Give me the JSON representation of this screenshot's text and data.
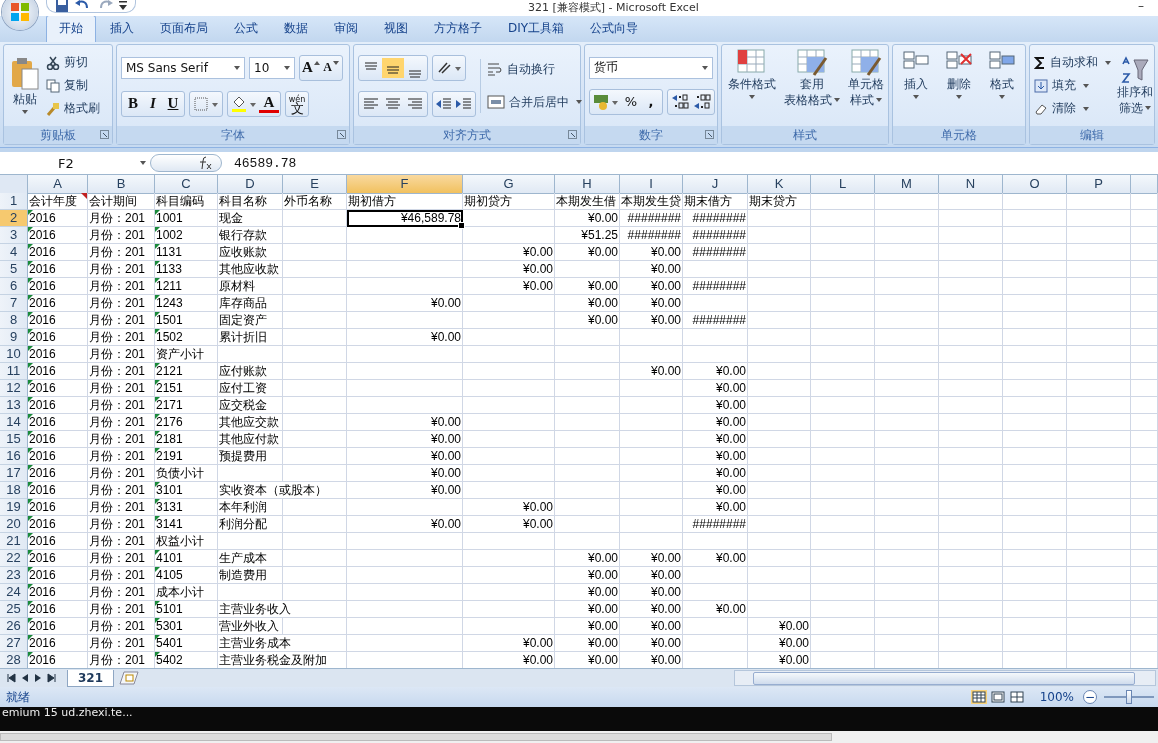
{
  "window": {
    "title": "321  [兼容模式] - Microsoft Excel",
    "minimize": "–"
  },
  "tabs": [
    {
      "label": "开始",
      "selected": true
    },
    {
      "label": "插入",
      "selected": false
    },
    {
      "label": "页面布局",
      "selected": false
    },
    {
      "label": "公式",
      "selected": false
    },
    {
      "label": "数据",
      "selected": false
    },
    {
      "label": "审阅",
      "selected": false
    },
    {
      "label": "视图",
      "selected": false
    },
    {
      "label": "方方格子",
      "selected": false
    },
    {
      "label": "DIY工具箱",
      "selected": false
    },
    {
      "label": "公式向导",
      "selected": false
    }
  ],
  "ribbon": {
    "clipboard": {
      "title": "剪贴板",
      "paste": "粘贴",
      "cut": "剪切",
      "copy": "复制",
      "painter": "格式刷"
    },
    "font": {
      "title": "字体",
      "family": "MS Sans Serif",
      "size": "10",
      "grow": "A",
      "shrink": "A",
      "bold": "B",
      "italic": "I",
      "underline": "U",
      "color_letter": "A",
      "phonetic_top": "wén",
      "phonetic": "文"
    },
    "alignment": {
      "title": "对齐方式",
      "vertical": [
        {
          "selected": false
        },
        {
          "selected": true
        },
        {
          "selected": false
        }
      ],
      "wrap": "自动换行",
      "merge": "合并后居中"
    },
    "number": {
      "title": "数字",
      "format": "货币",
      "percent": "%",
      "comma": ","
    },
    "styles": {
      "title": "样式",
      "items": [
        [
          "条件格式"
        ],
        [
          "套用",
          "表格格式"
        ],
        [
          "单元格",
          "样式"
        ]
      ]
    },
    "cells": {
      "title": "单元格",
      "items": [
        "插入",
        "删除",
        "格式"
      ]
    },
    "editing": {
      "title": "编辑",
      "autosum": "自动求和",
      "fill": "填充",
      "clear": "清除",
      "sort": [
        "排序和",
        "筛选"
      ]
    }
  },
  "formula_bar": {
    "name_box": "F2",
    "value": "46589.78"
  },
  "columns": [
    {
      "letter": "A",
      "selected": false
    },
    {
      "letter": "B",
      "selected": false
    },
    {
      "letter": "C",
      "selected": false
    },
    {
      "letter": "D",
      "selected": false
    },
    {
      "letter": "E",
      "selected": false
    },
    {
      "letter": "F",
      "selected": true
    },
    {
      "letter": "G",
      "selected": false
    },
    {
      "letter": "H",
      "selected": false
    },
    {
      "letter": "I",
      "selected": false
    },
    {
      "letter": "J",
      "selected": false
    },
    {
      "letter": "K",
      "selected": false
    },
    {
      "letter": "L",
      "selected": false
    },
    {
      "letter": "M",
      "selected": false
    },
    {
      "letter": "N",
      "selected": false
    },
    {
      "letter": "O",
      "selected": false
    },
    {
      "letter": "P",
      "selected": false
    }
  ],
  "rows": [
    {
      "num": "1",
      "selected": false,
      "a_comment": true,
      "cells": {
        "A": "会计年度",
        "B": "会计期间",
        "C": "科目编码",
        "D": "科目名称",
        "E": "外币名称",
        "F": "期初借方",
        "G": "期初贷方",
        "H": "本期发生借",
        "I": "本期发生贷",
        "J": "期末借方",
        "K": "期末贷方"
      }
    },
    {
      "num": "2",
      "selected": true,
      "a_flag": true,
      "c_flag": true,
      "cells": {
        "A": "2016",
        "B": "月份：201",
        "C": "1001",
        "D": "现金",
        "F": "¥46,589.78",
        "H": "¥0.00",
        "I": "########",
        "J": "########"
      }
    },
    {
      "num": "3",
      "selected": false,
      "a_flag": true,
      "c_flag": true,
      "cells": {
        "A": "2016",
        "B": "月份：201",
        "C": "1002",
        "D": "银行存款",
        "H": "¥51.25",
        "I": "########",
        "J": "########"
      }
    },
    {
      "num": "4",
      "selected": false,
      "a_flag": true,
      "c_flag": true,
      "cells": {
        "A": "2016",
        "B": "月份：201",
        "C": "1131",
        "D": "应收账款",
        "G": "¥0.00",
        "H": "¥0.00",
        "I": "¥0.00",
        "J": "########"
      }
    },
    {
      "num": "5",
      "selected": false,
      "a_flag": true,
      "c_flag": true,
      "cells": {
        "A": "2016",
        "B": "月份：201",
        "C": "1133",
        "D": "其他应收款",
        "G": "¥0.00",
        "I": "¥0.00"
      }
    },
    {
      "num": "6",
      "selected": false,
      "a_flag": true,
      "c_flag": true,
      "cells": {
        "A": "2016",
        "B": "月份：201",
        "C": "1211",
        "D": "原材料",
        "G": "¥0.00",
        "H": "¥0.00",
        "I": "¥0.00",
        "J": "########"
      }
    },
    {
      "num": "7",
      "selected": false,
      "a_flag": true,
      "c_flag": true,
      "cells": {
        "A": "2016",
        "B": "月份：201",
        "C": "1243",
        "D": "库存商品",
        "F": "¥0.00",
        "H": "¥0.00",
        "I": "¥0.00"
      }
    },
    {
      "num": "8",
      "selected": false,
      "a_flag": true,
      "c_flag": true,
      "cells": {
        "A": "2016",
        "B": "月份：201",
        "C": "1501",
        "D": "固定资产",
        "H": "¥0.00",
        "I": "¥0.00",
        "J": "########"
      }
    },
    {
      "num": "9",
      "selected": false,
      "a_flag": true,
      "c_flag": true,
      "cells": {
        "A": "2016",
        "B": "月份：201",
        "C": "1502",
        "D": "累计折旧",
        "F": "¥0.00"
      }
    },
    {
      "num": "10",
      "selected": false,
      "a_flag": true,
      "c_flag": false,
      "cells": {
        "A": "2016",
        "B": "月份：201",
        "C": "资产小计"
      }
    },
    {
      "num": "11",
      "selected": false,
      "a_flag": true,
      "c_flag": true,
      "cells": {
        "A": "2016",
        "B": "月份：201",
        "C": "2121",
        "D": "应付账款",
        "I": "¥0.00",
        "J": "¥0.00"
      }
    },
    {
      "num": "12",
      "selected": false,
      "a_flag": true,
      "c_flag": true,
      "cells": {
        "A": "2016",
        "B": "月份：201",
        "C": "2151",
        "D": "应付工资",
        "J": "¥0.00"
      }
    },
    {
      "num": "13",
      "selected": false,
      "a_flag": true,
      "c_flag": true,
      "cells": {
        "A": "2016",
        "B": "月份：201",
        "C": "2171",
        "D": "应交税金",
        "J": "¥0.00"
      }
    },
    {
      "num": "14",
      "selected": false,
      "a_flag": true,
      "c_flag": true,
      "cells": {
        "A": "2016",
        "B": "月份：201",
        "C": "2176",
        "D": "其他应交款",
        "F": "¥0.00",
        "J": "¥0.00"
      }
    },
    {
      "num": "15",
      "selected": false,
      "a_flag": true,
      "c_flag": true,
      "cells": {
        "A": "2016",
        "B": "月份：201",
        "C": "2181",
        "D": "其他应付款",
        "F": "¥0.00",
        "J": "¥0.00"
      }
    },
    {
      "num": "16",
      "selected": false,
      "a_flag": true,
      "c_flag": true,
      "cells": {
        "A": "2016",
        "B": "月份：201",
        "C": "2191",
        "D": "预提费用",
        "F": "¥0.00",
        "J": "¥0.00"
      }
    },
    {
      "num": "17",
      "selected": false,
      "a_flag": true,
      "c_flag": false,
      "cells": {
        "A": "2016",
        "B": "月份：201",
        "C": "负债小计",
        "F": "¥0.00",
        "J": "¥0.00"
      }
    },
    {
      "num": "18",
      "selected": false,
      "a_flag": true,
      "c_flag": true,
      "cells": {
        "A": "2016",
        "B": "月份：201",
        "C": "3101",
        "D": "实收资本（或股本）",
        "F": "¥0.00",
        "J": "¥0.00"
      }
    },
    {
      "num": "19",
      "selected": false,
      "a_flag": true,
      "c_flag": true,
      "cells": {
        "A": "2016",
        "B": "月份：201",
        "C": "3131",
        "D": "本年利润",
        "G": "¥0.00",
        "J": "¥0.00"
      }
    },
    {
      "num": "20",
      "selected": false,
      "a_flag": true,
      "c_flag": true,
      "cells": {
        "A": "2016",
        "B": "月份：201",
        "C": "3141",
        "D": "利润分配",
        "F": "¥0.00",
        "G": "¥0.00",
        "J": "########"
      }
    },
    {
      "num": "21",
      "selected": false,
      "a_flag": true,
      "c_flag": false,
      "cells": {
        "A": "2016",
        "B": "月份：201",
        "C": "权益小计"
      }
    },
    {
      "num": "22",
      "selected": false,
      "a_flag": true,
      "c_flag": true,
      "cells": {
        "A": "2016",
        "B": "月份：201",
        "C": "4101",
        "D": "生产成本",
        "H": "¥0.00",
        "I": "¥0.00",
        "J": "¥0.00"
      }
    },
    {
      "num": "23",
      "selected": false,
      "a_flag": true,
      "c_flag": true,
      "cells": {
        "A": "2016",
        "B": "月份：201",
        "C": "4105",
        "D": "制造费用",
        "H": "¥0.00",
        "I": "¥0.00"
      }
    },
    {
      "num": "24",
      "selected": false,
      "a_flag": true,
      "c_flag": false,
      "cells": {
        "A": "2016",
        "B": "月份：201",
        "C": "成本小计",
        "H": "¥0.00",
        "I": "¥0.00"
      }
    },
    {
      "num": "25",
      "selected": false,
      "a_flag": true,
      "c_flag": true,
      "cells": {
        "A": "2016",
        "B": "月份：201",
        "C": "5101",
        "D": "主营业务收入",
        "H": "¥0.00",
        "I": "¥0.00",
        "J": "¥0.00"
      }
    },
    {
      "num": "26",
      "selected": false,
      "a_flag": true,
      "c_flag": true,
      "cells": {
        "A": "2016",
        "B": "月份：201",
        "C": "5301",
        "D": "营业外收入",
        "H": "¥0.00",
        "I": "¥0.00",
        "K": "¥0.00"
      }
    },
    {
      "num": "27",
      "selected": false,
      "a_flag": true,
      "c_flag": true,
      "cells": {
        "A": "2016",
        "B": "月份：201",
        "C": "5401",
        "D": "主营业务成本",
        "G": "¥0.00",
        "H": "¥0.00",
        "I": "¥0.00",
        "K": "¥0.00"
      }
    },
    {
      "num": "28",
      "selected": false,
      "a_flag": true,
      "c_flag": true,
      "cells": {
        "A": "2016",
        "B": "月份：201",
        "C": "5402",
        "D": "主营业务税金及附加",
        "G": "¥0.00",
        "H": "¥0.00",
        "I": "¥0.00",
        "K": "¥0.00"
      }
    }
  ],
  "sheet_tabs": [
    {
      "label": "321",
      "selected": true
    }
  ],
  "status_bar": {
    "state": "就绪",
    "views": [
      {
        "selected": true
      },
      {
        "selected": false
      },
      {
        "selected": false
      }
    ],
    "zoom": "100%",
    "zoom_out": "−",
    "zoom_slider": {
      "level": 0.5
    }
  },
  "taskbar": {
    "text": "emium 15 ud.zhexi.te..."
  }
}
